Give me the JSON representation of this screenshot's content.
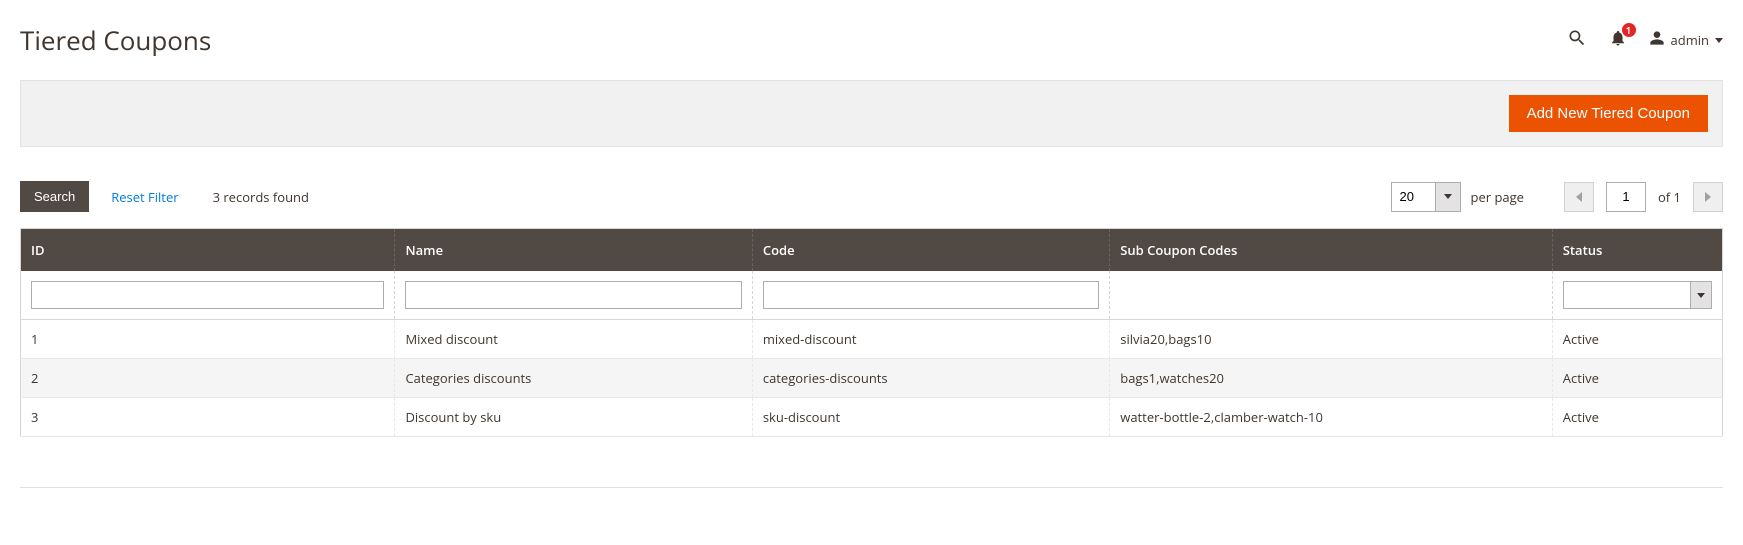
{
  "header": {
    "title": "Tiered Coupons",
    "notification_count": "1",
    "user_name": "admin"
  },
  "actions": {
    "add_button": "Add New Tiered Coupon"
  },
  "toolbar": {
    "search_label": "Search",
    "reset_label": "Reset Filter",
    "records_found": "3 records found",
    "per_page_value": "20",
    "per_page_label": "per page",
    "current_page": "1",
    "of_label": "of 1"
  },
  "columns": {
    "id": "ID",
    "name": "Name",
    "code": "Code",
    "sub": "Sub Coupon Codes",
    "status": "Status"
  },
  "rows": [
    {
      "id": "1",
      "name": "Mixed discount",
      "code": "mixed-discount",
      "sub": "silvia20,bags10",
      "status": "Active"
    },
    {
      "id": "2",
      "name": "Categories discounts",
      "code": "categories-discounts",
      "sub": "bags1,watches20",
      "status": "Active"
    },
    {
      "id": "3",
      "name": "Discount by sku",
      "code": "sku-discount",
      "sub": "watter-bottle-2,clamber-watch-10",
      "status": "Active"
    }
  ]
}
